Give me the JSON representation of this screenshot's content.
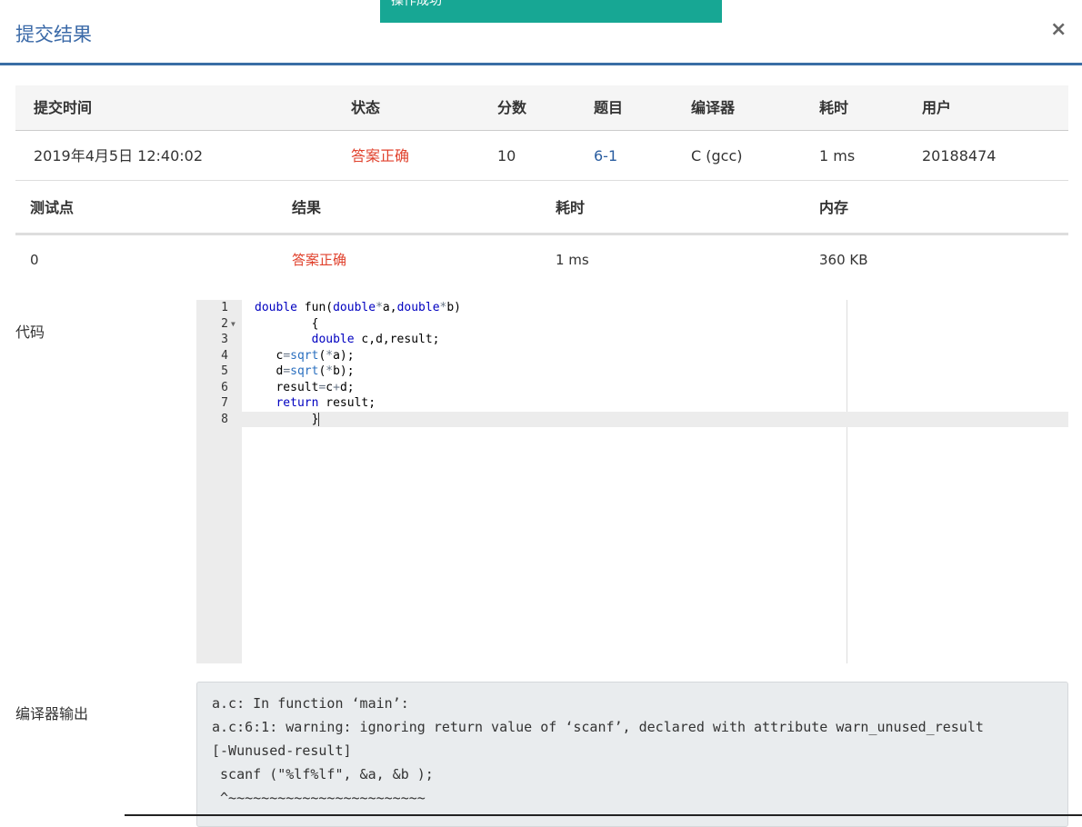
{
  "toast": {
    "text": "操作成功"
  },
  "dialog": {
    "title": "提交结果",
    "close_symbol": "×"
  },
  "summary": {
    "headers": [
      "提交时间",
      "状态",
      "分数",
      "题目",
      "编译器",
      "耗时",
      "用户"
    ],
    "row": {
      "time": "2019年4月5日 12:40:02",
      "status": "答案正确",
      "score": "10",
      "problem": "6-1",
      "compiler": "C (gcc)",
      "duration": "1 ms",
      "user": "20188474"
    }
  },
  "tests": {
    "headers": [
      "测试点",
      "结果",
      "耗时",
      "内存"
    ],
    "rows": [
      {
        "point": "0",
        "result": "答案正确",
        "duration": "1 ms",
        "memory": "360 KB"
      }
    ]
  },
  "code_section": {
    "label": "代码",
    "line_numbers": [
      "1",
      "2",
      "3",
      "4",
      "5",
      "6",
      "7",
      "8"
    ]
  },
  "compiler_output": {
    "label": "编译器输出",
    "lines": [
      "a.c: In function ‘main’:",
      "a.c:6:1: warning: ignoring return value of ‘scanf’, declared with attribute warn_unused_result",
      "[-Wunused-result]",
      " scanf (\"%lf%lf\", &a, &b );",
      " ^~~~~~~~~~~~~~~~~~~~~~~~~"
    ]
  },
  "colors": {
    "accent": "#3a6ea5",
    "success_toast": "#17a794",
    "correct": "#e0412c"
  }
}
